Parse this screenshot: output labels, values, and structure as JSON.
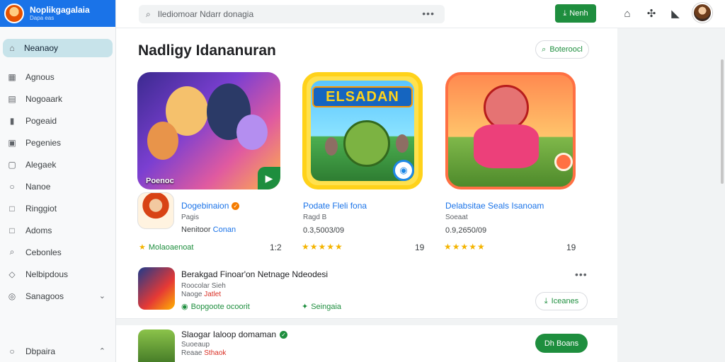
{
  "brand": {
    "title": "Noplikgagalaia",
    "subtitle": "Dapa eas"
  },
  "sidebar": {
    "active": {
      "label": "Neanaoy",
      "icon": "home-icon"
    },
    "items": [
      {
        "label": "Agnous",
        "icon": "grid-icon"
      },
      {
        "label": "Nogoaark",
        "icon": "book-icon"
      },
      {
        "label": "Pogeaid",
        "icon": "bookmark-icon"
      },
      {
        "label": "Pegenies",
        "icon": "briefcase-icon"
      },
      {
        "label": "Alegaek",
        "icon": "device-icon"
      },
      {
        "label": "Nanoe",
        "icon": "circle-icon"
      },
      {
        "label": "Ringgiot",
        "icon": "square-icon"
      },
      {
        "label": "Adoms",
        "icon": "square-icon"
      },
      {
        "label": "Cebonles",
        "icon": "search-icon"
      },
      {
        "label": "Nelbipdous",
        "icon": "tag-icon"
      },
      {
        "label": "Sanagoos",
        "icon": "settings-icon"
      }
    ],
    "bottom": {
      "label": "Dbpaira"
    }
  },
  "topbar": {
    "search_placeholder": "Ilediomoar Ndarr donagia",
    "install_label": "Nenh"
  },
  "section": {
    "title": "Nadligy Idananuran",
    "action_label": "Boteroocl"
  },
  "cards": [
    {
      "art_label": "Poenoc",
      "title": "Dogebinaion",
      "sub": "Pagis",
      "meta": "Nenitoor",
      "meta_tag": "Conan",
      "tag": "Molaoaenoat",
      "score": "1:2"
    },
    {
      "logo_text": "ELSADAN",
      "title": "Podate Fleli fona",
      "sub": "Ragd B",
      "meta": "0.3,5003/09",
      "stars": "★★★★★",
      "score": "19"
    },
    {
      "title": "Delabsitae Seals Isanoam",
      "sub": "Soeaat",
      "meta": "0.9,2650/09",
      "stars": "★★★★★",
      "score": "19"
    }
  ],
  "rows": [
    {
      "title": "Berakgad Finoar'on Netnage Ndeodesi",
      "sub": "Roocolar Sieh",
      "sub2": "Naoge",
      "sub2_red": "Jatlet",
      "tag": "Bopgoote ocoorit",
      "tag2": "Seingaia",
      "button": "Iceanes"
    },
    {
      "title": "Slaogar Ialoop domaman",
      "sub": "Suoeaup",
      "sub2": "Reaae",
      "sub2_red": "Sthaok",
      "button": "Dh Boans"
    }
  ]
}
